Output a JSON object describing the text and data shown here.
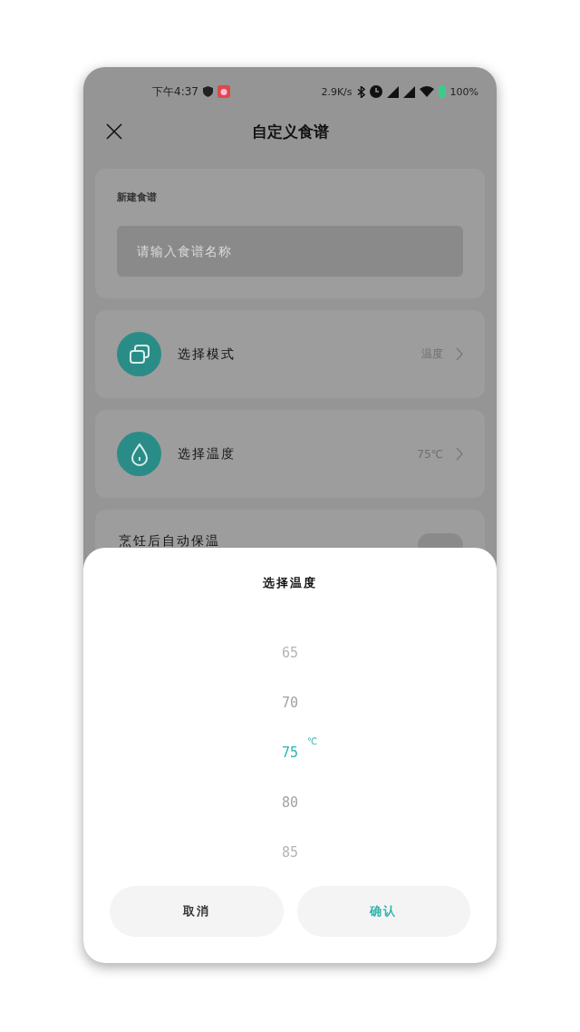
{
  "status_bar": {
    "time": "下午4:37",
    "speed": "2.9K/s",
    "battery": "100%"
  },
  "header": {
    "title": "自定义食谱"
  },
  "new_recipe": {
    "label": "新建食谱",
    "placeholder": "请输入食谱名称"
  },
  "settings": [
    {
      "kind": "mode",
      "label": "选择模式",
      "value": "温度"
    },
    {
      "kind": "temperature",
      "label": "选择温度",
      "value": "75℃"
    }
  ],
  "keep_warm": {
    "label": "烹饪后自动保温",
    "on": false
  },
  "sheet": {
    "title": "选择温度",
    "unit": "℃",
    "options": [
      {
        "label": "65",
        "selected": false
      },
      {
        "label": "70",
        "selected": false
      },
      {
        "label": "75",
        "selected": true
      },
      {
        "label": "80",
        "selected": false
      },
      {
        "label": "85",
        "selected": false
      }
    ],
    "buttons": [
      {
        "kind": "cancel",
        "label": "取消"
      },
      {
        "kind": "confirm",
        "label": "确认"
      }
    ]
  }
}
